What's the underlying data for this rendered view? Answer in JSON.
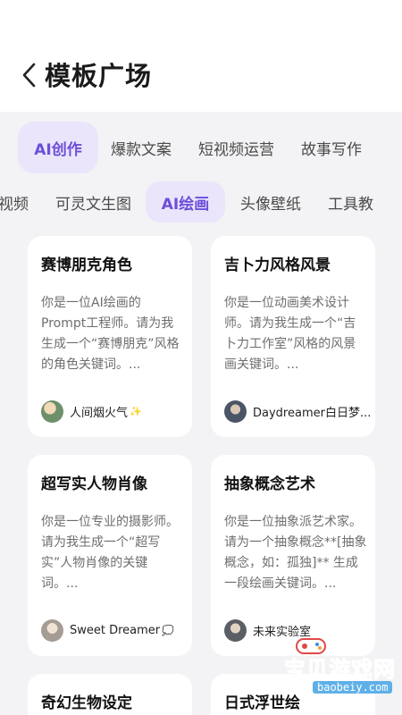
{
  "header": {
    "title": "模板广场"
  },
  "primary_tabs": [
    {
      "label": "AI创作",
      "active": true
    },
    {
      "label": "爆款文案",
      "active": false
    },
    {
      "label": "短视频运营",
      "active": false
    },
    {
      "label": "故事写作",
      "active": false
    }
  ],
  "secondary_tabs": [
    {
      "label": "视频",
      "active": false
    },
    {
      "label": "可灵文生图",
      "active": false
    },
    {
      "label": "AI绘画",
      "active": true
    },
    {
      "label": "头像壁纸",
      "active": false
    },
    {
      "label": "工具教",
      "active": false
    }
  ],
  "cards": [
    {
      "title": "赛博朋克角色",
      "desc": "你是一位AI绘画的Prompt工程师。请为我生成一个“赛博朋克”风格的角色关键词。...",
      "author": "人间烟火气",
      "author_suffix": "✨"
    },
    {
      "title": "吉卜力风格风景",
      "desc": "你是一位动画美术设计师。请为我生成一个“吉卜力工作室”风格的风景画关键词。...",
      "author": "Daydreamer白日梦...",
      "author_suffix": ""
    },
    {
      "title": "超写实人物肖像",
      "desc": "你是一位专业的摄影师。请为我生成一个“超写实”人物肖像的关键词。...",
      "author": "Sweet Dreamer",
      "author_suffix": "💭"
    },
    {
      "title": "抽象概念艺术",
      "desc": "你是一位抽象派艺术家。请为一个抽象概念**[抽象概念，如：孤独]** 生成一段绘画关键词。...",
      "author": "未来实验室",
      "author_suffix": ""
    },
    {
      "title": "奇幻生物设定",
      "desc": "",
      "author": "",
      "author_suffix": ""
    },
    {
      "title": "日式浮世绘",
      "desc": "",
      "author": "",
      "author_suffix": ""
    }
  ],
  "watermark": {
    "text": "宝贝游戏网",
    "url": "baobeiy.com"
  },
  "colors": {
    "accent": "#6b4fd8",
    "accent_bg": "#ebe5fb",
    "page_bg": "#f3f3f5"
  }
}
